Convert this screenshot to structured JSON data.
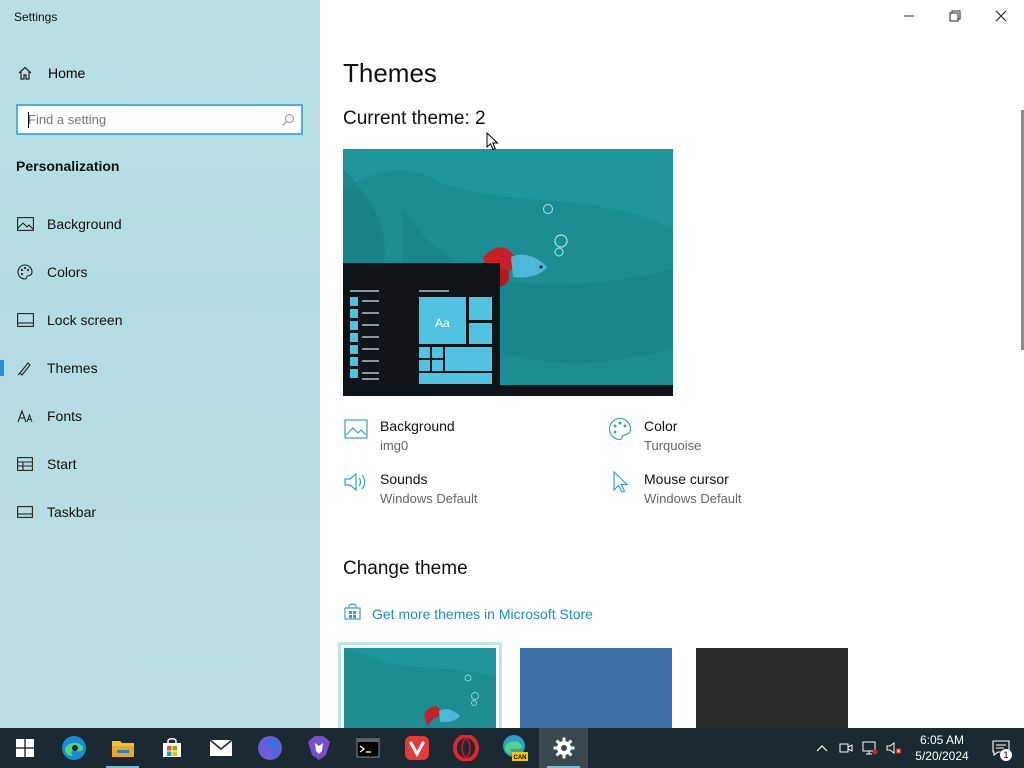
{
  "window": {
    "title": "Settings"
  },
  "sidebar": {
    "home_label": "Home",
    "search_placeholder": "Find a setting",
    "section": "Personalization",
    "items": [
      {
        "label": "Background",
        "icon": "image-icon"
      },
      {
        "label": "Colors",
        "icon": "palette-icon"
      },
      {
        "label": "Lock screen",
        "icon": "lock-screen-icon"
      },
      {
        "label": "Themes",
        "icon": "themes-icon",
        "active": true
      },
      {
        "label": "Fonts",
        "icon": "fonts-icon"
      },
      {
        "label": "Start",
        "icon": "start-icon"
      },
      {
        "label": "Taskbar",
        "icon": "taskbar-icon"
      }
    ]
  },
  "main": {
    "title": "Themes",
    "current_theme": "Current theme: 2",
    "preview_tile_text": "Aa",
    "properties": [
      {
        "name": "Background",
        "value": "img0",
        "icon": "image-icon"
      },
      {
        "name": "Color",
        "value": "Turquoise",
        "icon": "palette-icon"
      },
      {
        "name": "Sounds",
        "value": "Windows Default",
        "icon": "speaker-icon"
      },
      {
        "name": "Mouse cursor",
        "value": "Windows Default",
        "icon": "cursor-icon"
      }
    ],
    "change_theme": "Change theme",
    "store_link": "Get more themes in Microsoft Store",
    "themes": [
      {
        "name": "theme-2",
        "color": "#1a8a90",
        "selected": true
      },
      {
        "name": "theme-blue",
        "color": "#3d6ea8",
        "selected": false
      },
      {
        "name": "theme-dark",
        "color": "#2b2b2b",
        "selected": false
      }
    ]
  },
  "colors": {
    "accent": "#2b8fd8",
    "link": "#1f8fb8",
    "teal": "#1a8a90",
    "taskbar": "#1b2a32"
  },
  "taskbar": {
    "apps": [
      {
        "name": "start-button",
        "icon": "windows-icon"
      },
      {
        "name": "edge",
        "icon": "edge-icon"
      },
      {
        "name": "file-explorer",
        "icon": "folder-icon",
        "running": true
      },
      {
        "name": "microsoft-store",
        "icon": "store-icon"
      },
      {
        "name": "mail",
        "icon": "mail-icon"
      },
      {
        "name": "firefox",
        "icon": "firefox-icon"
      },
      {
        "name": "brave",
        "icon": "brave-icon"
      },
      {
        "name": "terminal",
        "icon": "terminal-icon"
      },
      {
        "name": "vivaldi",
        "icon": "vivaldi-icon"
      },
      {
        "name": "opera",
        "icon": "opera-icon"
      },
      {
        "name": "edge-canary",
        "icon": "edge-canary-icon",
        "badge": "CAN"
      },
      {
        "name": "settings",
        "icon": "gear-icon",
        "running": true,
        "active": true
      }
    ],
    "time": "6:05 AM",
    "date": "5/20/2024",
    "notification_count": "1"
  }
}
